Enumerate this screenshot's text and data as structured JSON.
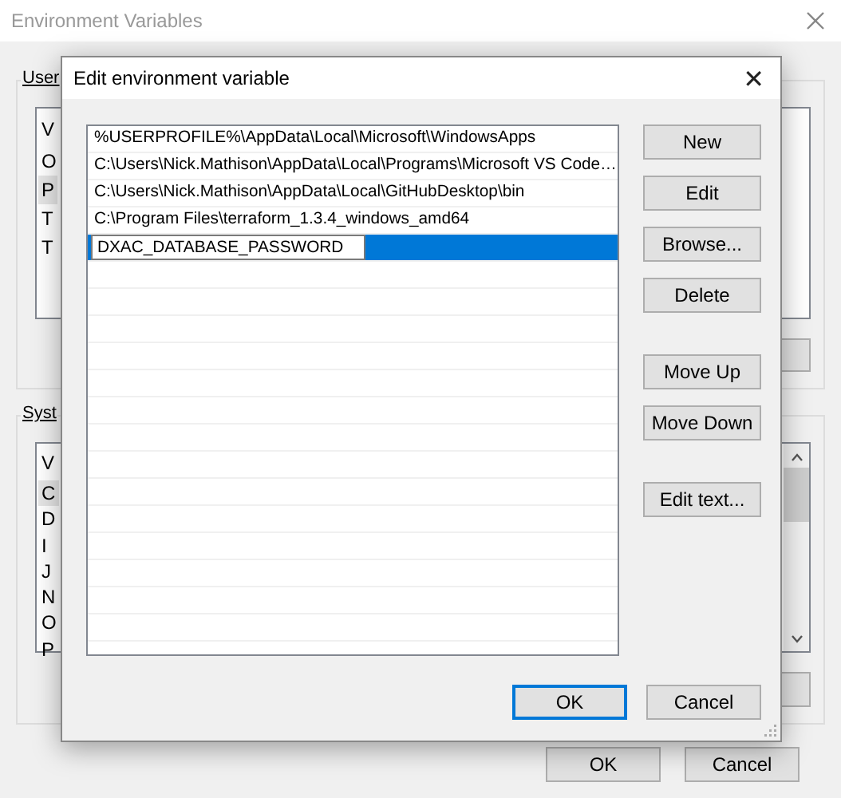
{
  "window": {
    "title": "Environment Variables"
  },
  "user_group": {
    "label": "User",
    "list_header": "V",
    "items": [
      {
        "text": "O",
        "selected": false
      },
      {
        "text": "P",
        "selected": true
      },
      {
        "text": "T",
        "selected": false
      },
      {
        "text": "T",
        "selected": false
      }
    ]
  },
  "system_group": {
    "label": "Syst",
    "list_header": "V",
    "items": [
      {
        "text": "C",
        "selected": true
      },
      {
        "text": "D",
        "selected": false
      },
      {
        "text": "I",
        "selected": false
      },
      {
        "text": "J",
        "selected": false
      },
      {
        "text": "N",
        "selected": false
      },
      {
        "text": "O",
        "selected": false
      },
      {
        "text": "P",
        "selected": false
      }
    ]
  },
  "footer_buttons": [
    {
      "label": "OK"
    },
    {
      "label": "Cancel"
    }
  ],
  "dialog": {
    "title": "Edit environment variable",
    "close": "✕",
    "entries": [
      {
        "kind": "text",
        "text": "%USERPROFILE%\\AppData\\Local\\Microsoft\\WindowsApps",
        "selected": false
      },
      {
        "kind": "text",
        "text": "C:\\Users\\Nick.Mathison\\AppData\\Local\\Programs\\Microsoft VS Code…",
        "selected": false
      },
      {
        "kind": "text",
        "text": "C:\\Users\\Nick.Mathison\\AppData\\Local\\GitHubDesktop\\bin",
        "selected": false
      },
      {
        "kind": "text",
        "text": "C:\\Program Files\\terraform_1.3.4_windows_amd64",
        "selected": false
      },
      {
        "kind": "edit",
        "text": "DXAC_DATABASE_PASSWORD",
        "selected": true
      }
    ],
    "side_button_groups": [
      [
        "New",
        "Edit",
        "Browse...",
        "Delete"
      ],
      [
        "Move Up",
        "Move Down"
      ],
      [
        "Edit text..."
      ]
    ],
    "buttons": [
      {
        "label": "OK",
        "default": true
      },
      {
        "label": "Cancel",
        "default": false
      }
    ]
  }
}
